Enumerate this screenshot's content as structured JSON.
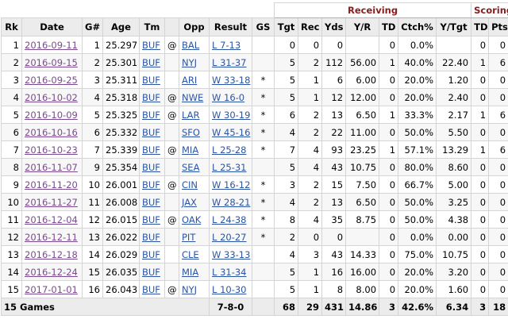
{
  "groups": {
    "receiving": "Receiving",
    "scoring": "Scoring"
  },
  "columns": [
    "Rk",
    "Date",
    "G#",
    "Age",
    "Tm",
    "",
    "Opp",
    "Result",
    "GS",
    "Tgt",
    "Rec",
    "Yds",
    "Y/R",
    "TD",
    "Ctch%",
    "Y/Tgt",
    "TD",
    "Pts"
  ],
  "rows": [
    {
      "rk": "1",
      "date": "2016-09-11",
      "g": "1",
      "age": "25.297",
      "tm": "BUF",
      "at": "@",
      "opp": "BAL",
      "result": "L 7-13",
      "gs": "",
      "tgt": "0",
      "rec": "0",
      "yds": "0",
      "ypr": "",
      "td": "0",
      "ctch": "0.0%",
      "ytgt": "",
      "std": "0",
      "pts": "0"
    },
    {
      "rk": "2",
      "date": "2016-09-15",
      "g": "2",
      "age": "25.301",
      "tm": "BUF",
      "at": "",
      "opp": "NYJ",
      "result": "L 31-37",
      "gs": "",
      "tgt": "5",
      "rec": "2",
      "yds": "112",
      "ypr": "56.00",
      "td": "1",
      "ctch": "40.0%",
      "ytgt": "22.40",
      "std": "1",
      "pts": "6"
    },
    {
      "rk": "3",
      "date": "2016-09-25",
      "g": "3",
      "age": "25.311",
      "tm": "BUF",
      "at": "",
      "opp": "ARI",
      "result": "W 33-18",
      "gs": "*",
      "tgt": "5",
      "rec": "1",
      "yds": "6",
      "ypr": "6.00",
      "td": "0",
      "ctch": "20.0%",
      "ytgt": "1.20",
      "std": "0",
      "pts": "0"
    },
    {
      "rk": "4",
      "date": "2016-10-02",
      "g": "4",
      "age": "25.318",
      "tm": "BUF",
      "at": "@",
      "opp": "NWE",
      "result": "W 16-0",
      "gs": "*",
      "tgt": "5",
      "rec": "1",
      "yds": "12",
      "ypr": "12.00",
      "td": "0",
      "ctch": "20.0%",
      "ytgt": "2.40",
      "std": "0",
      "pts": "0"
    },
    {
      "rk": "5",
      "date": "2016-10-09",
      "g": "5",
      "age": "25.325",
      "tm": "BUF",
      "at": "@",
      "opp": "LAR",
      "result": "W 30-19",
      "gs": "*",
      "tgt": "6",
      "rec": "2",
      "yds": "13",
      "ypr": "6.50",
      "td": "1",
      "ctch": "33.3%",
      "ytgt": "2.17",
      "std": "1",
      "pts": "6"
    },
    {
      "rk": "6",
      "date": "2016-10-16",
      "g": "6",
      "age": "25.332",
      "tm": "BUF",
      "at": "",
      "opp": "SFO",
      "result": "W 45-16",
      "gs": "*",
      "tgt": "4",
      "rec": "2",
      "yds": "22",
      "ypr": "11.00",
      "td": "0",
      "ctch": "50.0%",
      "ytgt": "5.50",
      "std": "0",
      "pts": "0"
    },
    {
      "rk": "7",
      "date": "2016-10-23",
      "g": "7",
      "age": "25.339",
      "tm": "BUF",
      "at": "@",
      "opp": "MIA",
      "result": "L 25-28",
      "gs": "*",
      "tgt": "7",
      "rec": "4",
      "yds": "93",
      "ypr": "23.25",
      "td": "1",
      "ctch": "57.1%",
      "ytgt": "13.29",
      "std": "1",
      "pts": "6"
    },
    {
      "rk": "8",
      "date": "2016-11-07",
      "g": "9",
      "age": "25.354",
      "tm": "BUF",
      "at": "",
      "opp": "SEA",
      "result": "L 25-31",
      "gs": "",
      "tgt": "5",
      "rec": "4",
      "yds": "43",
      "ypr": "10.75",
      "td": "0",
      "ctch": "80.0%",
      "ytgt": "8.60",
      "std": "0",
      "pts": "0"
    },
    {
      "rk": "9",
      "date": "2016-11-20",
      "g": "10",
      "age": "26.001",
      "tm": "BUF",
      "at": "@",
      "opp": "CIN",
      "result": "W 16-12",
      "gs": "*",
      "tgt": "3",
      "rec": "2",
      "yds": "15",
      "ypr": "7.50",
      "td": "0",
      "ctch": "66.7%",
      "ytgt": "5.00",
      "std": "0",
      "pts": "0"
    },
    {
      "rk": "10",
      "date": "2016-11-27",
      "g": "11",
      "age": "26.008",
      "tm": "BUF",
      "at": "",
      "opp": "JAX",
      "result": "W 28-21",
      "gs": "*",
      "tgt": "4",
      "rec": "2",
      "yds": "13",
      "ypr": "6.50",
      "td": "0",
      "ctch": "50.0%",
      "ytgt": "3.25",
      "std": "0",
      "pts": "0"
    },
    {
      "rk": "11",
      "date": "2016-12-04",
      "g": "12",
      "age": "26.015",
      "tm": "BUF",
      "at": "@",
      "opp": "OAK",
      "result": "L 24-38",
      "gs": "*",
      "tgt": "8",
      "rec": "4",
      "yds": "35",
      "ypr": "8.75",
      "td": "0",
      "ctch": "50.0%",
      "ytgt": "4.38",
      "std": "0",
      "pts": "0"
    },
    {
      "rk": "12",
      "date": "2016-12-11",
      "g": "13",
      "age": "26.022",
      "tm": "BUF",
      "at": "",
      "opp": "PIT",
      "result": "L 20-27",
      "gs": "*",
      "tgt": "2",
      "rec": "0",
      "yds": "0",
      "ypr": "",
      "td": "0",
      "ctch": "0.0%",
      "ytgt": "0.00",
      "std": "0",
      "pts": "0"
    },
    {
      "rk": "13",
      "date": "2016-12-18",
      "g": "14",
      "age": "26.029",
      "tm": "BUF",
      "at": "",
      "opp": "CLE",
      "result": "W 33-13",
      "gs": "",
      "tgt": "4",
      "rec": "3",
      "yds": "43",
      "ypr": "14.33",
      "td": "0",
      "ctch": "75.0%",
      "ytgt": "10.75",
      "std": "0",
      "pts": "0"
    },
    {
      "rk": "14",
      "date": "2016-12-24",
      "g": "15",
      "age": "26.035",
      "tm": "BUF",
      "at": "",
      "opp": "MIA",
      "result": "L 31-34",
      "gs": "",
      "tgt": "5",
      "rec": "1",
      "yds": "16",
      "ypr": "16.00",
      "td": "0",
      "ctch": "20.0%",
      "ytgt": "3.20",
      "std": "0",
      "pts": "0"
    },
    {
      "rk": "15",
      "date": "2017-01-01",
      "g": "16",
      "age": "26.043",
      "tm": "BUF",
      "at": "@",
      "opp": "NYJ",
      "result": "L 10-30",
      "gs": "",
      "tgt": "5",
      "rec": "1",
      "yds": "8",
      "ypr": "8.00",
      "td": "0",
      "ctch": "20.0%",
      "ytgt": "1.60",
      "std": "0",
      "pts": "0"
    }
  ],
  "totals": {
    "label": "15 Games",
    "result": "7-8-0",
    "tgt": "68",
    "rec": "29",
    "yds": "431",
    "ypr": "14.86",
    "td": "3",
    "ctch": "42.6%",
    "ytgt": "6.34",
    "std": "3",
    "pts": "18"
  },
  "colors": {
    "link_visited": "#7b4a8e",
    "link": "#2b55a4",
    "group_header": "#8a1c1c",
    "header_bg": "#ececec"
  }
}
